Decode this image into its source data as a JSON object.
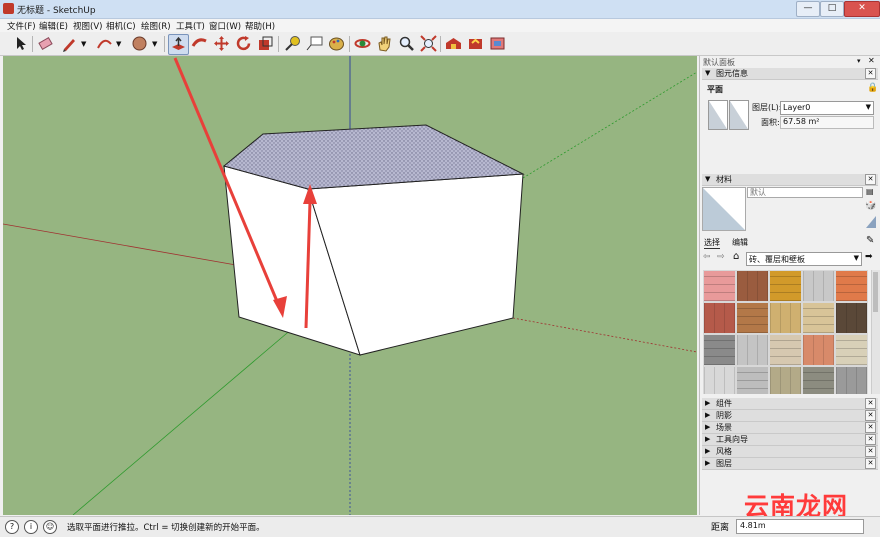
{
  "window": {
    "title": "无标题 - SketchUp",
    "minimize": "—",
    "maximize": "□",
    "close": "✕"
  },
  "menu": [
    "文件(F)",
    "编辑(E)",
    "视图(V)",
    "相机(C)",
    "绘图(R)",
    "工具(T)",
    "窗口(W)",
    "帮助(H)"
  ],
  "toolbar": {
    "tools": [
      "select-tool",
      "eraser-tool",
      "pencil-tool",
      "arc-tool",
      "paint-bucket-tool",
      "push-pull-tool",
      "follow-me-tool",
      "move-tool",
      "rotate-tool",
      "scale-tool",
      "tape-measure-tool",
      "text-tool",
      "dimension-tool",
      "orbit-tool",
      "pan-tool",
      "zoom-tool",
      "zoom-extents-tool",
      "warehouse-tool",
      "share-model-tool",
      "extension-tool"
    ],
    "active": "push-pull-tool"
  },
  "tray": {
    "title": "默认面板",
    "entity_info": {
      "header": "图元信息",
      "type": "平面",
      "layer_label": "图层(L):",
      "layer_value": "Layer0",
      "area_label": "面积:",
      "area_value": "67.58 m²"
    },
    "materials": {
      "header": "材料",
      "name_placeholder": "默认",
      "tabs": [
        "选择",
        "编辑"
      ],
      "collection": "砖、覆层和壁板",
      "swatch_colors": [
        "#e89a9a",
        "#9a5c3f",
        "#d29a2a",
        "#c8c8c8",
        "#e07a4a",
        "#b55a4a",
        "#b37848",
        "#cfb070",
        "#d8c498",
        "#5a4838",
        "#8a8a8a",
        "#c4c4c4",
        "#d6c8b0",
        "#d88a6a",
        "#d8d0b8",
        "#d8d8d8",
        "#bdbdbd",
        "#b3aa88",
        "#8c8c80",
        "#9a9a9a"
      ]
    },
    "sections": [
      "组件",
      "阴影",
      "场景",
      "工具向导",
      "风格",
      "图层"
    ]
  },
  "status": {
    "message": "选取平面进行推拉。Ctrl = 切换创建新的开始平面。",
    "measure_label": "距离",
    "measure_value": "4.81m"
  },
  "watermark": "云南龙网"
}
